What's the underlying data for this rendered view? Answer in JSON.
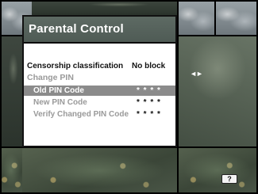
{
  "screen": {
    "title": "Parental Control"
  },
  "menu": {
    "censorship": {
      "label": "Censorship classification",
      "value": "No block"
    },
    "change_pin": {
      "label": "Change PIN"
    },
    "old_pin": {
      "label": "Old PIN Code",
      "value": "* * * *"
    },
    "new_pin": {
      "label": "New PIN Code",
      "value": "* * * *"
    },
    "verify_pin": {
      "label": "Verify Changed PIN Code",
      "value": "* * * *"
    }
  },
  "controls": {
    "nav_indicator": "◄►",
    "help_label": "?"
  },
  "colors": {
    "title_bar": "#55615b",
    "selected_row": "#8b8b8b",
    "disabled_text": "#9a9a9a"
  }
}
